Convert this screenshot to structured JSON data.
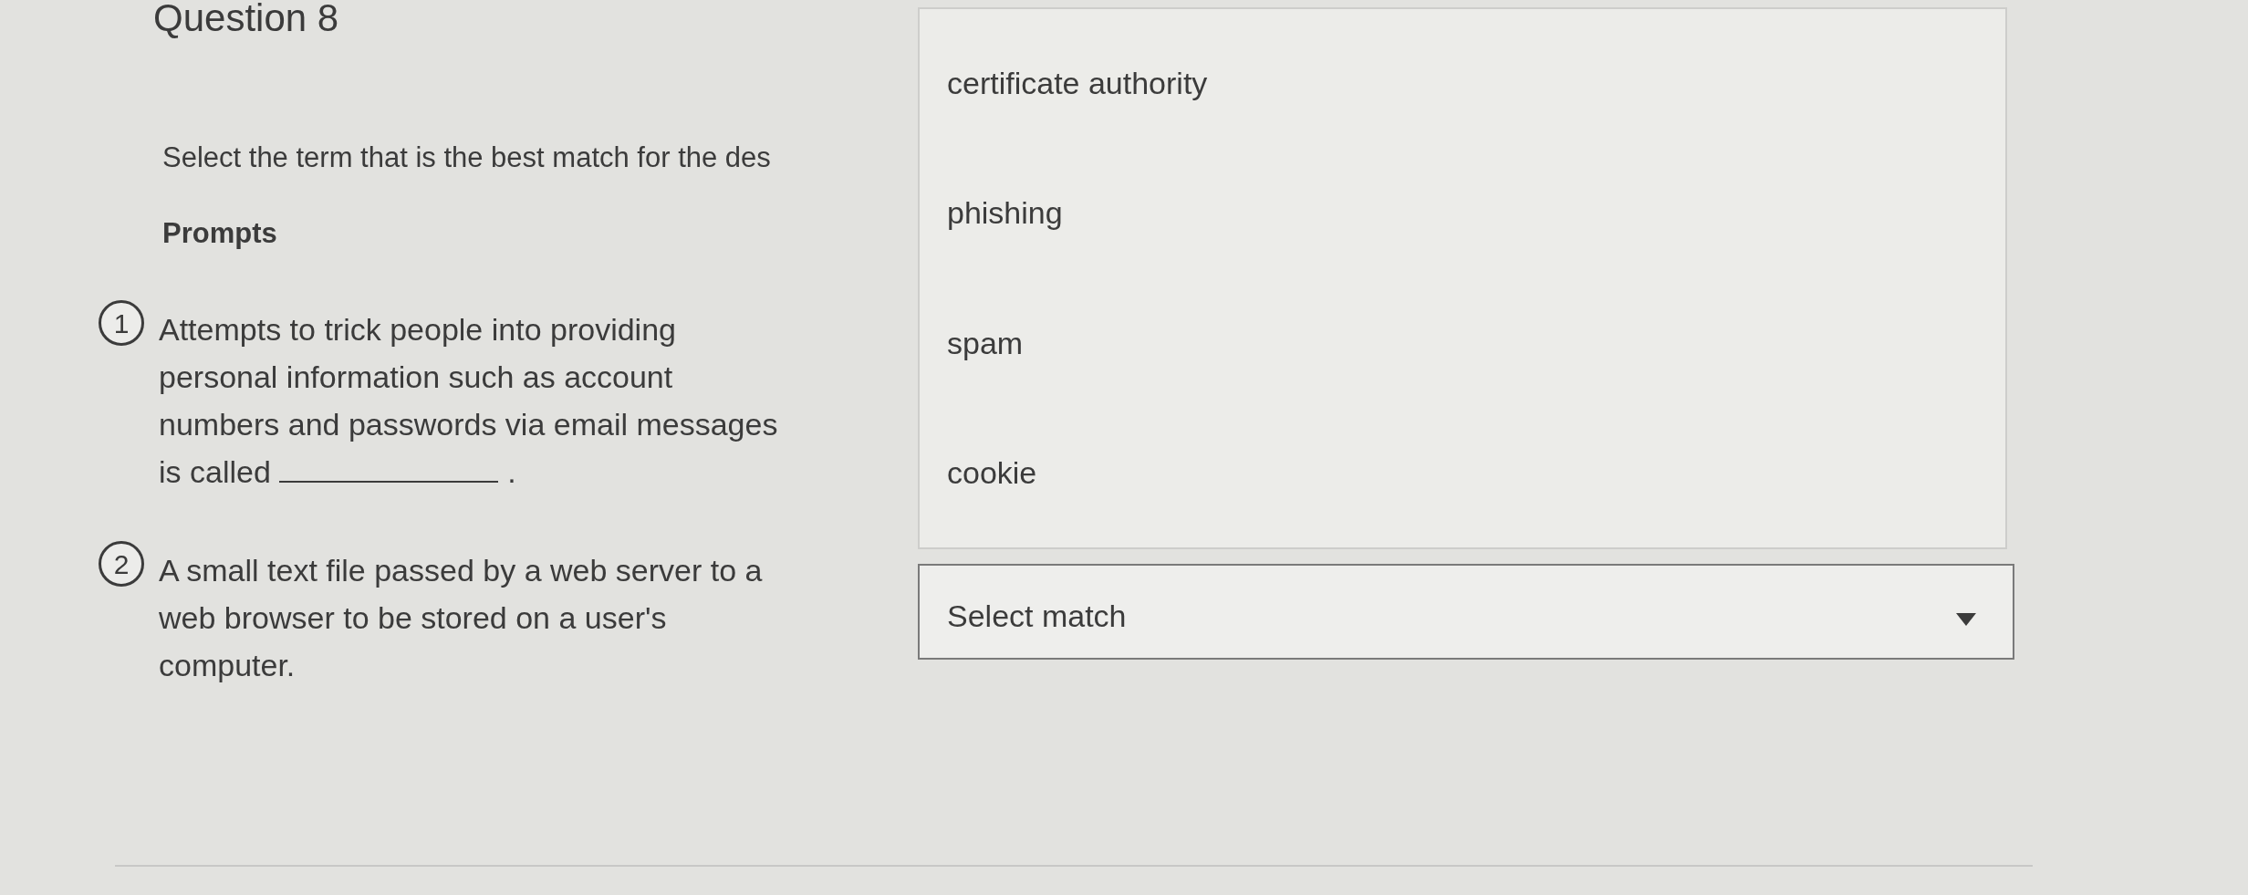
{
  "question": {
    "title": "Question 8",
    "instruction": "Select the term that is the best match for the des",
    "prompts_label": "Prompts",
    "prompts": [
      {
        "kind": "blank",
        "number": "1",
        "text": "Attempts to trick people into providing personal information such as account numbers and passwords via email messages is called",
        "after_blank": "."
      },
      {
        "kind": "plain",
        "number": "2",
        "text": "A small text file passed by a web server to a web browser to be stored on a user's computer."
      }
    ]
  },
  "match_select": {
    "placeholder": "Select match",
    "expanded": true,
    "options": [
      "certificate authority",
      "phishing",
      "spam",
      "cookie"
    ]
  }
}
